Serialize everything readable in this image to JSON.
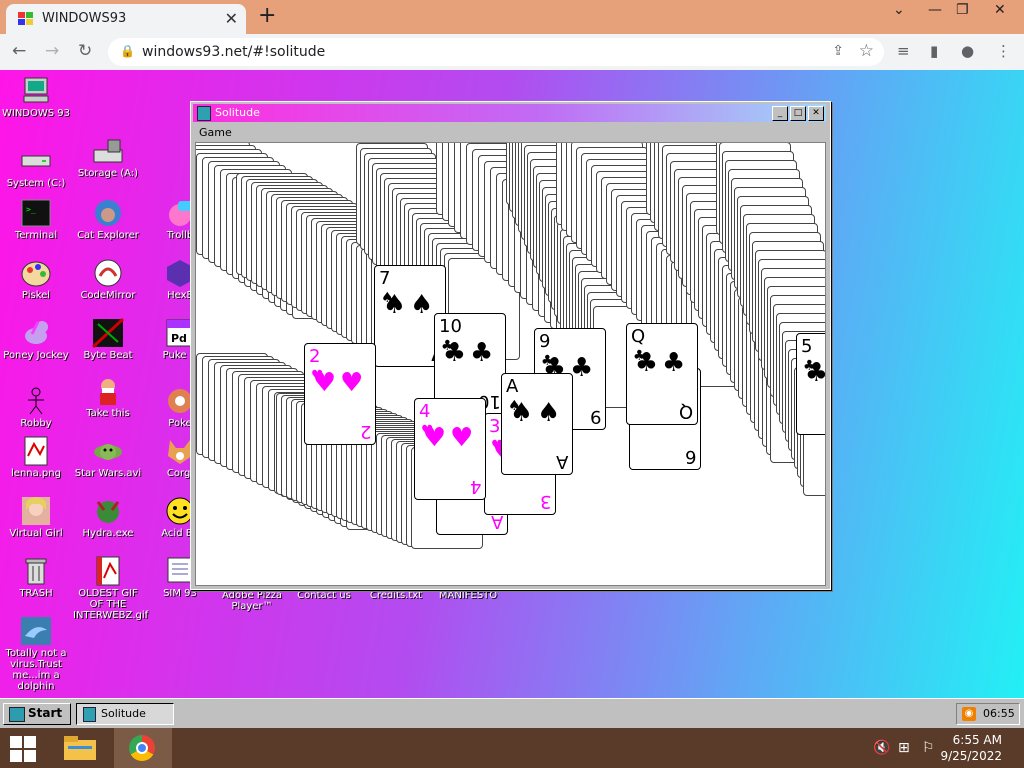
{
  "browser": {
    "tab_title": "WINDOWS93",
    "tab_close": "✕",
    "new_tab": "+",
    "url": "windows93.net/#!solitude",
    "window_controls": [
      "⌄",
      "—",
      "❐",
      "✕"
    ]
  },
  "desktop": {
    "icons": [
      {
        "label": "WINDOWS 93"
      },
      {
        "label": "System (C:)"
      },
      {
        "label": "Storage (A:)"
      },
      {
        "label": "Terminal"
      },
      {
        "label": "Cat Explorer"
      },
      {
        "label": "Trollb"
      },
      {
        "label": "Piskel"
      },
      {
        "label": "CodeMirror"
      },
      {
        "label": "HexE"
      },
      {
        "label": "Poney Jockey"
      },
      {
        "label": "Byte Beat"
      },
      {
        "label": "Puke D"
      },
      {
        "label": "Robby"
      },
      {
        "label": "Take this"
      },
      {
        "label": "Poke"
      },
      {
        "label": "lenna.png"
      },
      {
        "label": "Star Wars.avi"
      },
      {
        "label": "Corgi"
      },
      {
        "label": "Virtual Girl"
      },
      {
        "label": "Hydra.exe"
      },
      {
        "label": "Acid Bo"
      },
      {
        "label": "TRASH"
      },
      {
        "label": "OLDEST GIF OF THE INTERWEBZ.gif"
      },
      {
        "label": "SIM 93"
      },
      {
        "label": "Adobe Pizza Player™"
      },
      {
        "label": "Contact us"
      },
      {
        "label": "Credits.txt"
      },
      {
        "label": "MANIFESTO"
      },
      {
        "label": "Totally not a virus.Trust me...im a dolphin"
      }
    ]
  },
  "window": {
    "title": "Solitude",
    "menu": "Game",
    "buttons": [
      "_",
      "□",
      "✕"
    ]
  },
  "cards": [
    {
      "rank": "7",
      "suit": "♠",
      "color": "blk"
    },
    {
      "rank": "10",
      "suit": "♣",
      "color": "blk"
    },
    {
      "rank": "2",
      "suit": "♥",
      "color": "red"
    },
    {
      "rank": "9",
      "suit": "♣",
      "color": "blk"
    },
    {
      "rank": "6",
      "suit": "♣",
      "color": "blk"
    },
    {
      "rank": "A",
      "suit": "♦",
      "color": "red"
    },
    {
      "rank": "3",
      "suit": "♥",
      "color": "red"
    },
    {
      "rank": "4",
      "suit": "♥",
      "color": "red"
    },
    {
      "rank": "5",
      "suit": "♣",
      "color": "blk"
    },
    {
      "rank": "Q",
      "suit": "♣",
      "color": "blk"
    },
    {
      "rank": "A",
      "suit": "♠",
      "color": "blk"
    }
  ],
  "taskbar93": {
    "start": "Start",
    "task": "Solitude",
    "clock": "06:55"
  },
  "wintaskbar": {
    "time": "6:55 AM",
    "date": "9/25/2022"
  }
}
